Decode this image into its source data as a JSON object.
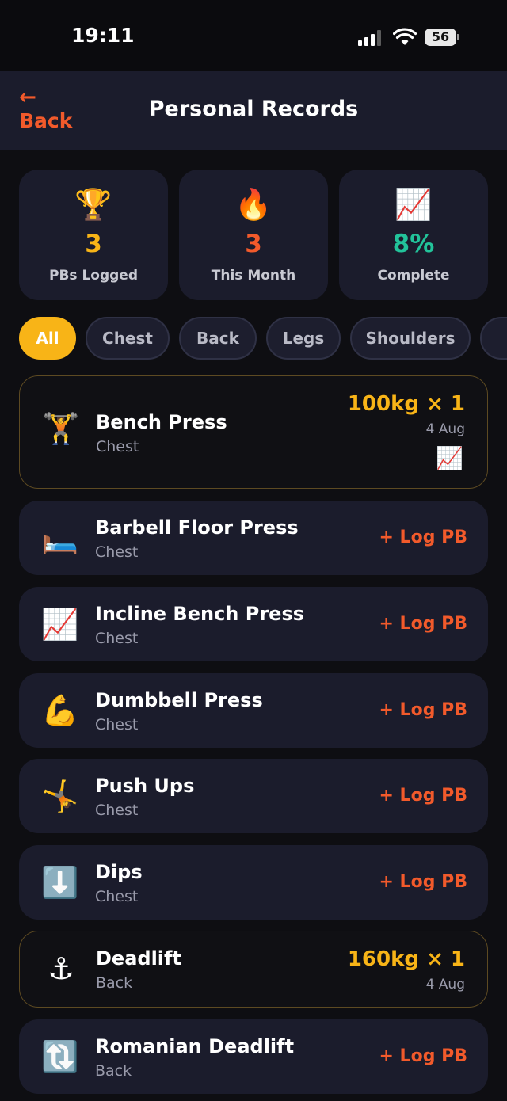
{
  "status": {
    "time": "19:11",
    "battery": "56"
  },
  "header": {
    "back_arrow": "←",
    "back_label": "Back",
    "title": "Personal Records"
  },
  "stats": [
    {
      "icon": "🏆",
      "icon_name": "trophy-icon",
      "value": "3",
      "label": "PBs Logged",
      "color": "#f8b417"
    },
    {
      "icon": "🔥",
      "icon_name": "fire-icon",
      "value": "3",
      "label": "This Month",
      "color": "#f25a2b"
    },
    {
      "icon": "📈",
      "icon_name": "chart-increasing-icon",
      "value": "8%",
      "label": "Complete",
      "color": "#22c39a"
    }
  ],
  "filters": [
    {
      "label": "All",
      "active": true
    },
    {
      "label": "Chest",
      "active": false
    },
    {
      "label": "Back",
      "active": false
    },
    {
      "label": "Legs",
      "active": false
    },
    {
      "label": "Shoulders",
      "active": false
    }
  ],
  "records": [
    {
      "icon": "🏋️",
      "icon_name": "weightlifter-icon",
      "name": "Bench Press",
      "category": "Chest",
      "value": "100kg × 1",
      "date": "4 Aug",
      "chart_icon": "📈"
    },
    {
      "icon": "🛏️",
      "icon_name": "bed-icon",
      "name": "Barbell Floor Press",
      "category": "Chest",
      "action": "+ Log PB"
    },
    {
      "icon": "📈",
      "icon_name": "chart-increasing-icon",
      "name": "Incline Bench Press",
      "category": "Chest",
      "action": "+ Log PB"
    },
    {
      "icon": "💪",
      "icon_name": "flexed-biceps-icon",
      "name": "Dumbbell Press",
      "category": "Chest",
      "action": "+ Log PB"
    },
    {
      "icon": "🤸",
      "icon_name": "cartwheel-icon",
      "name": "Push Ups",
      "category": "Chest",
      "action": "+ Log PB"
    },
    {
      "icon": "⬇️",
      "icon_name": "down-arrow-icon",
      "name": "Dips",
      "category": "Chest",
      "action": "+ Log PB"
    },
    {
      "icon": "⚓",
      "icon_name": "anchor-icon",
      "name": "Deadlift",
      "category": "Back",
      "value": "160kg × 1",
      "date": "4 Aug"
    },
    {
      "icon": "🔃",
      "icon_name": "clockwise-arrows-icon",
      "name": "Romanian Deadlift",
      "category": "Back",
      "action": "+ Log PB"
    }
  ]
}
